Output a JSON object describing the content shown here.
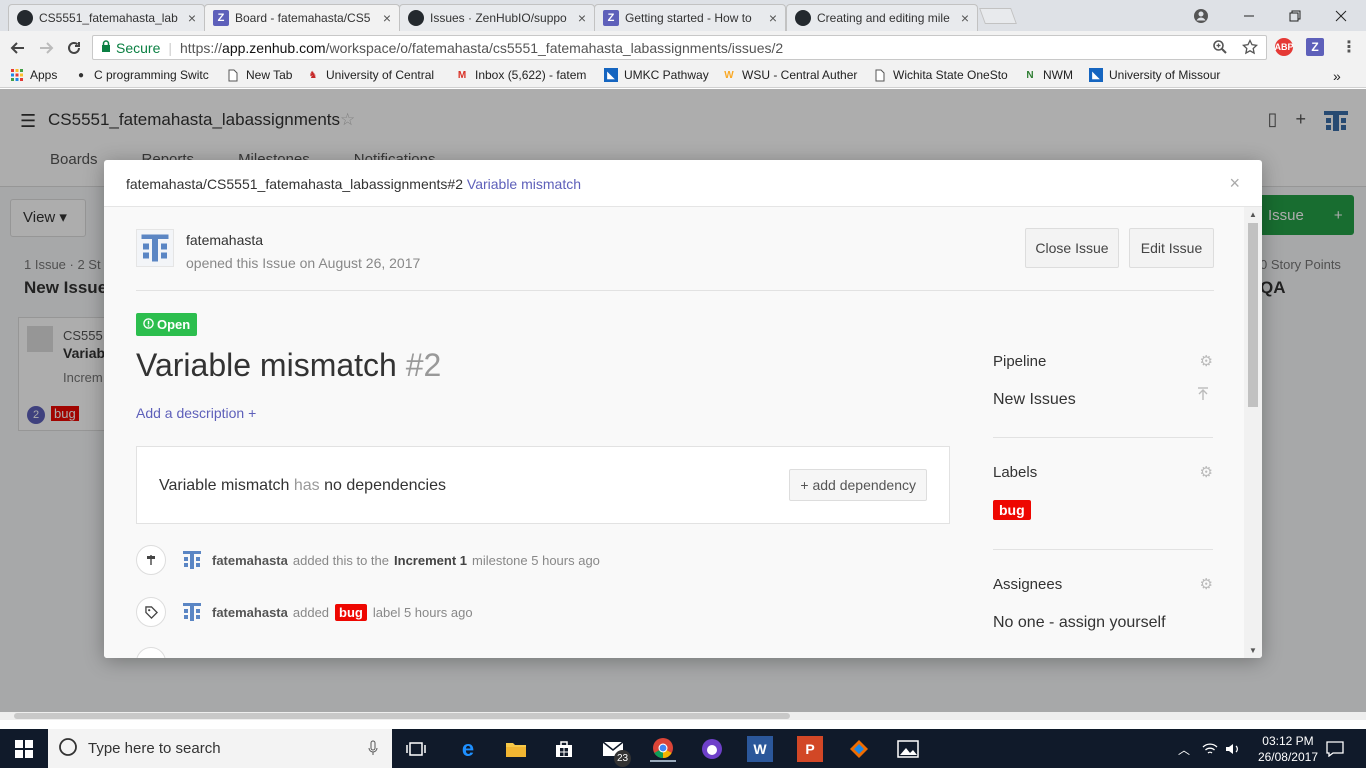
{
  "browser": {
    "tabs": [
      {
        "label": "CS5551_fatemahasta_lab",
        "icon": "github-icon"
      },
      {
        "label": "Board - fatemahasta/CS5",
        "icon": "zenhub-icon",
        "active": true
      },
      {
        "label": "Issues · ZenHubIO/suppo",
        "icon": "github-icon"
      },
      {
        "label": "Getting started - How to",
        "icon": "zenhub-icon"
      },
      {
        "label": "Creating and editing mile",
        "icon": "github-icon"
      }
    ],
    "tab_close": "×",
    "secure_label": "Secure",
    "url_prefix": "https://",
    "url_host": "app.zenhub.com",
    "url_path": "/workspace/o/fatemahasta/cs5551_fatemahasta_labassignments/issues/2",
    "ext_abp": "ABP",
    "ext_z": "Z",
    "bookmarks": [
      {
        "label": "Apps",
        "icon": "apps-grid-icon"
      },
      {
        "label": "C programming Switc",
        "icon": "site-icon"
      },
      {
        "label": "New Tab",
        "icon": "page-icon"
      },
      {
        "label": "University of Central",
        "icon": "ucm-icon"
      },
      {
        "label": "Inbox (5,622) - fatem",
        "icon": "gmail-icon"
      },
      {
        "label": "UMKC Pathway",
        "icon": "umkc-icon"
      },
      {
        "label": "WSU - Central Auther",
        "icon": "wsu-icon"
      },
      {
        "label": "Wichita State OneSto",
        "icon": "page-icon"
      },
      {
        "label": "NWM",
        "icon": "nwm-icon"
      },
      {
        "label": "University of Missour",
        "icon": "umkc-icon"
      }
    ],
    "more": "»"
  },
  "app": {
    "title": "CS5551_fatemahasta_labassignments",
    "tabs": [
      "Boards",
      "Reports",
      "Milestones",
      "Notifications"
    ],
    "view_label": "View",
    "col1_count": "1 Issue · 2 St",
    "col1_title": "New Issues",
    "col_last_count": "0 Story Points",
    "col_last_title": "QA",
    "card_title": "CS555",
    "card_sub": "Variab",
    "card_milestone": "Increm",
    "card_num": "2",
    "card_label": "bug",
    "new_issue_label": "Issue"
  },
  "modal": {
    "repo": "fatemahasta/CS5551_fatemahasta_labassignments#2",
    "title_link": "Variable mismatch",
    "close": "×",
    "author": "fatemahasta",
    "opened_text": "opened this Issue on August 26, 2017",
    "close_issue": "Close Issue",
    "edit_issue": "Edit Issue",
    "state": "Open",
    "issue_title": "Variable mismatch",
    "issue_number": "#2",
    "add_description": "Add a description +",
    "dependency": {
      "name": "Variable mismatch",
      "has": "has",
      "none": "no dependencies",
      "button": "+ add dependency"
    },
    "events": [
      {
        "user": "fatemahasta",
        "pre": "added this to the",
        "strong": "Increment 1",
        "post": "milestone 5 hours ago"
      },
      {
        "user": "fatemahasta",
        "pre": "added",
        "label": "bug",
        "post": "label 5 hours ago"
      }
    ],
    "sidebar": {
      "pipeline_label": "Pipeline",
      "pipeline_value": "New Issues",
      "labels_label": "Labels",
      "label_value": "bug",
      "assignees_label": "Assignees",
      "assignees_value": "No one - assign yourself"
    }
  },
  "taskbar": {
    "search_placeholder": "Type here to search",
    "mail_badge": "23",
    "time": "03:12 PM",
    "date": "26/08/2017"
  },
  "colors": {
    "zenhub_purple": "#5e60ba",
    "open_green": "#2cbe4e",
    "bug_red": "#ee0701"
  }
}
